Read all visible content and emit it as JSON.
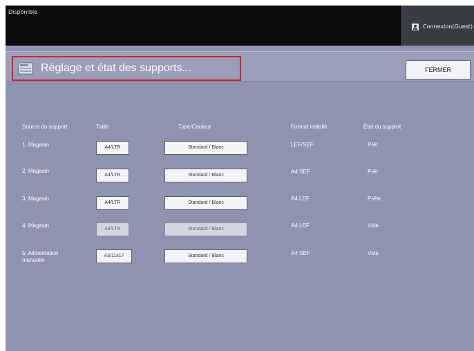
{
  "app": {
    "title": "Disponible"
  },
  "user": {
    "label": "Connexion(Guest)"
  },
  "header": {
    "title": "Réglage et état des supports...",
    "close_label": "FERMER"
  },
  "columns": {
    "source": "Source du support",
    "size": "Taille",
    "type": "Type/Couleur",
    "format": "Format installé",
    "status": "État du support"
  },
  "rows": [
    {
      "source": "1. Magasin",
      "size": "A4/LTR",
      "type": "Standard / Blanc",
      "format": "LEF/SEF",
      "status": "Prêt",
      "dim": false
    },
    {
      "source": "2. Magasin",
      "size": "A4/LTR",
      "type": "Standard / Blanc",
      "format": "A4 SEF",
      "status": "Prêt",
      "dim": false
    },
    {
      "source": "3. Magasin",
      "size": "A4/LTR",
      "type": "Standard / Blanc",
      "format": "A4 LEF",
      "status": "Prête",
      "dim": false
    },
    {
      "source": "4. Magasin",
      "size": "A4/LTR",
      "type": "Standard / Blanc",
      "format": "A4 LEF",
      "status": "Vide",
      "dim": true
    },
    {
      "source": "5. Alimentation manuelle",
      "size": "A3/11x17",
      "type": "Standard / Blanc",
      "format": "A4 SEF",
      "status": "Vide",
      "dim": false
    }
  ]
}
